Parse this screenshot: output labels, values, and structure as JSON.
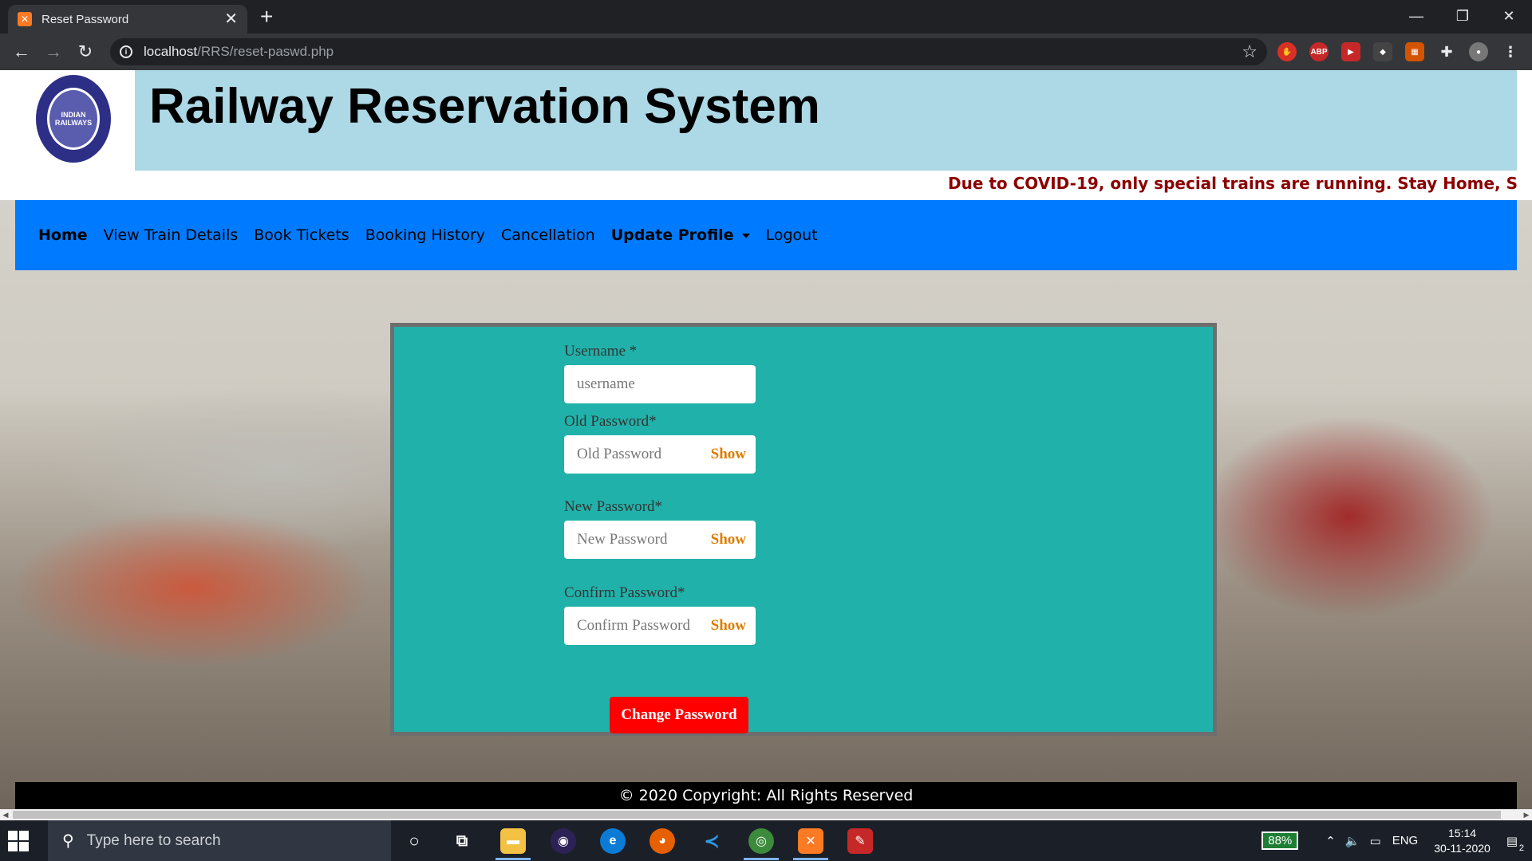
{
  "browser": {
    "tab_title": "Reset Password",
    "tab_close": "✕",
    "new_tab": "+",
    "url_host": "localhost",
    "url_path": "/RRS/reset-paswd.php"
  },
  "header": {
    "site_title": "Railway Reservation System",
    "logo_text": "INDIAN RAILWAYS",
    "marquee": "Due to COVID-19, only special trains are running. Stay Home, S"
  },
  "nav": {
    "items": [
      {
        "label": "Home"
      },
      {
        "label": "View Train Details"
      },
      {
        "label": "Book Tickets"
      },
      {
        "label": "Booking History"
      },
      {
        "label": "Cancellation"
      },
      {
        "label": "Update Profile"
      },
      {
        "label": "Logout"
      }
    ]
  },
  "form": {
    "username_label": "Username *",
    "username_placeholder": "username",
    "old_label": "Old Password*",
    "old_placeholder": "Old Password",
    "new_label": "New Password*",
    "new_placeholder": "New Password",
    "confirm_label": "Confirm Password*",
    "confirm_placeholder": "Confirm Password",
    "show_label": "Show",
    "submit_label": "Change Password"
  },
  "footer": {
    "text": "© 2020 Copyright: All Rights Reserved"
  },
  "taskbar": {
    "search_placeholder": "Type here to search",
    "battery": "88%",
    "language": "ENG",
    "time": "15:14",
    "date": "30-11-2020",
    "notifications": "2"
  },
  "colors": {
    "nav_bg": "#007bff",
    "title_banner": "#add8e6",
    "card_bg": "#20b2aa",
    "submit_bg": "#ff0000",
    "marquee": "#8b0000",
    "show": "#e07b00"
  }
}
